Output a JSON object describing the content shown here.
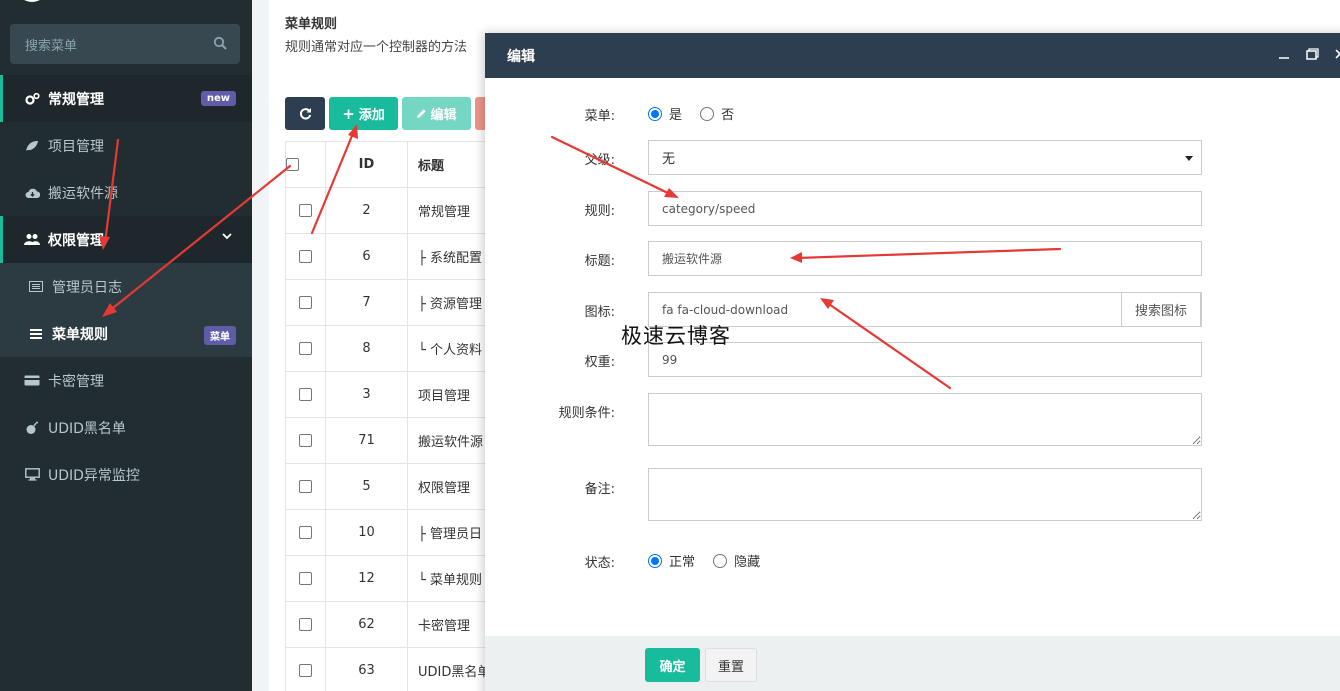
{
  "sidebar": {
    "search_placeholder": "搜索菜单",
    "items": [
      {
        "label": "常规管理",
        "badge": "new"
      },
      {
        "label": "项目管理"
      },
      {
        "label": "搬运软件源"
      },
      {
        "label": "权限管理"
      },
      {
        "label": "管理员日志"
      },
      {
        "label": "菜单规则",
        "badge": "菜单"
      },
      {
        "label": "卡密管理"
      },
      {
        "label": "UDID黑名单"
      },
      {
        "label": "UDID异常监控"
      }
    ]
  },
  "page": {
    "title": "菜单规则",
    "subtitle": "规则通常对应一个控制器的方法"
  },
  "toolbar": {
    "add_label": "添加",
    "edit_label": "编辑"
  },
  "table": {
    "headers": {
      "id": "ID",
      "title": "标题"
    },
    "rows": [
      {
        "id": "2",
        "title": "常规管理"
      },
      {
        "id": "6",
        "title": "├ 系统配置"
      },
      {
        "id": "7",
        "title": "├ 资源管理"
      },
      {
        "id": "8",
        "title": "└ 个人资料"
      },
      {
        "id": "3",
        "title": "项目管理"
      },
      {
        "id": "71",
        "title": "搬运软件源"
      },
      {
        "id": "5",
        "title": "权限管理"
      },
      {
        "id": "10",
        "title": "├ 管理员日"
      },
      {
        "id": "12",
        "title": "└ 菜单规则"
      },
      {
        "id": "62",
        "title": "卡密管理"
      },
      {
        "id": "63",
        "title": "UDID黑名单"
      }
    ]
  },
  "modal": {
    "title": "编辑",
    "fields": {
      "menu_label": "菜单:",
      "menu_yes": "是",
      "menu_no": "否",
      "parent_label": "父级:",
      "parent_value": "无",
      "rule_label": "规则:",
      "rule_value": "category/speed",
      "title_label": "标题:",
      "title_value": "搬运软件源",
      "icon_label": "图标:",
      "icon_value": "fa fa-cloud-download",
      "icon_search": "搜索图标",
      "weight_label": "权重:",
      "weight_value": "99",
      "condition_label": "规则条件:",
      "remark_label": "备注:",
      "status_label": "状态:",
      "status_normal": "正常",
      "status_hidden": "隐藏"
    },
    "ok_label": "确定",
    "reset_label": "重置"
  },
  "watermark": "极速云博客",
  "colors": {
    "sidebar_bg": "#222d32",
    "accent": "#18bc9c",
    "modal_header": "#2c3e50",
    "badge": "#605ca8",
    "arrow": "#e53935"
  }
}
